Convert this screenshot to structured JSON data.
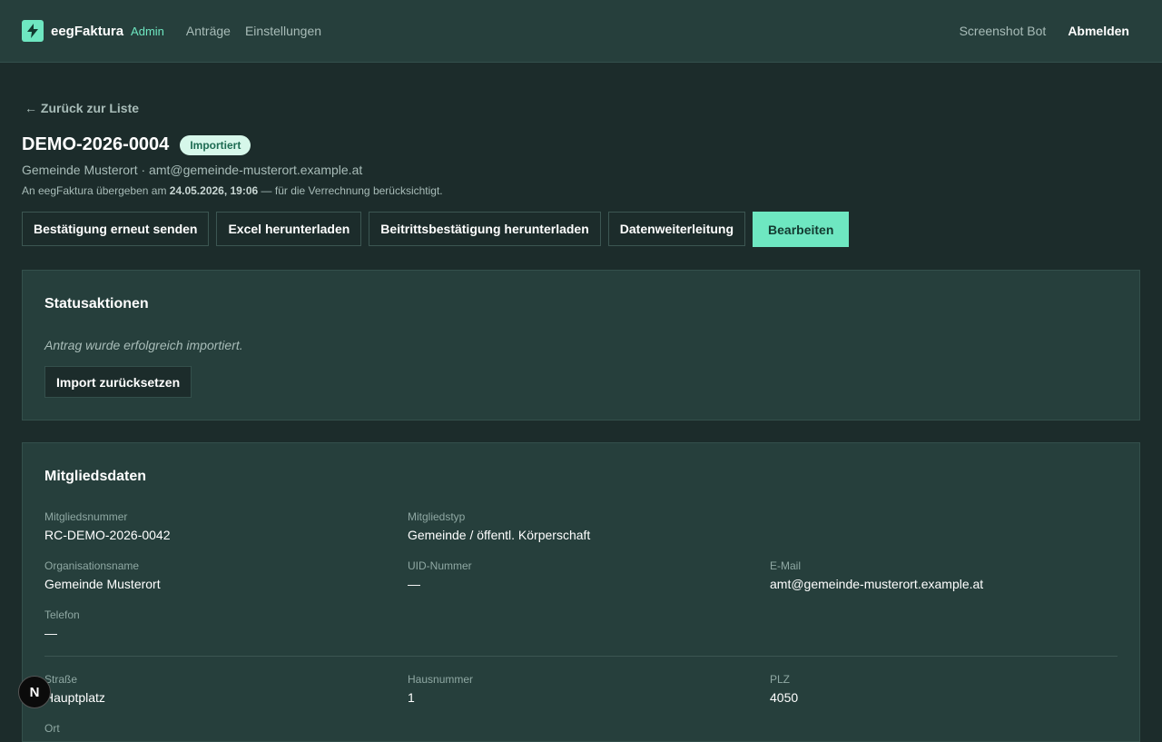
{
  "header": {
    "brand": "eegFaktura",
    "role": "Admin",
    "nav": [
      "Anträge",
      "Einstellungen"
    ],
    "user": "Screenshot Bot",
    "logout": "Abmelden"
  },
  "page": {
    "back_link": "← Zurück zur Liste",
    "title": "DEMO-2026-0004",
    "status_badge": "Importiert",
    "subtitle": "Gemeinde Musterort · amt@gemeinde-musterort.example.at",
    "note_prefix": "An eegFaktura übergeben am ",
    "note_date": "24.05.2026, 19:06",
    "note_suffix": " — für die Verrechnung berücksichtigt."
  },
  "actions": {
    "resend": "Bestätigung erneut senden",
    "excel": "Excel herunterladen",
    "membership": "Beitrittsbestätigung herunterladen",
    "forwarding": "Datenweiterleitung",
    "edit": "Bearbeiten"
  },
  "status_panel": {
    "title": "Statusaktionen",
    "message": "Antrag wurde erfolgreich importiert.",
    "reset_button": "Import zurücksetzen"
  },
  "member_panel": {
    "title": "Mitgliedsdaten",
    "fields": [
      {
        "label": "Mitgliedsnummer",
        "value": "RC-DEMO-2026-0042"
      },
      {
        "label": "Mitgliedstyp",
        "value": "Gemeinde / öffentl. Körperschaft"
      },
      {
        "label": "Organisationsname",
        "value": "Gemeinde Musterort"
      },
      {
        "label": "UID-Nummer",
        "value": "—"
      },
      {
        "label": "E-Mail",
        "value": "amt@gemeinde-musterort.example.at"
      },
      {
        "label": "Telefon",
        "value": "—"
      },
      {
        "label": "Straße",
        "value": "Hauptplatz"
      },
      {
        "label": "Hausnummer",
        "value": "1"
      },
      {
        "label": "PLZ",
        "value": "4050"
      },
      {
        "label": "Ort",
        "value": ""
      }
    ]
  },
  "dev_badge": "N",
  "colors": {
    "background": "#1c2c2b",
    "panel": "#263f3c",
    "accent": "#6ee7c1",
    "badge_bg": "#d6f7ea",
    "badge_text": "#1d6b52"
  }
}
